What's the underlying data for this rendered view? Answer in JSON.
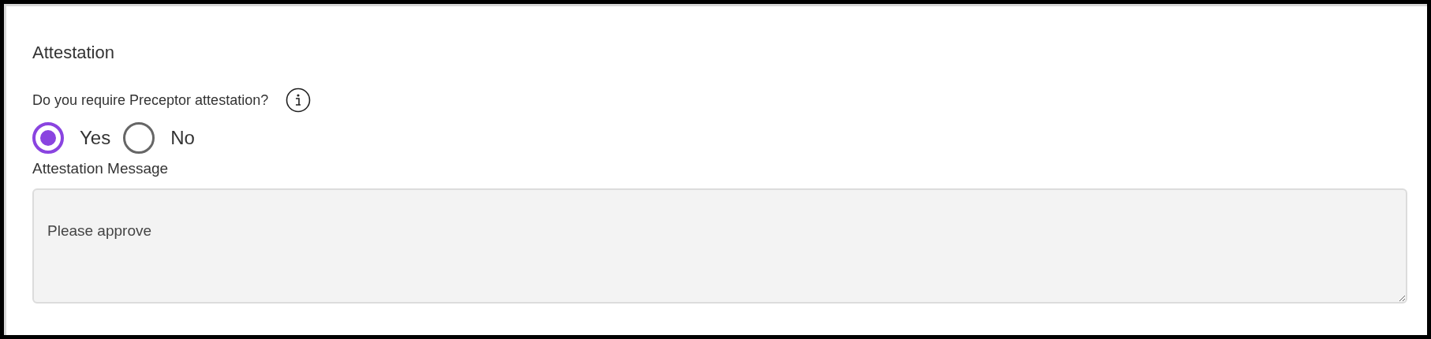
{
  "section": {
    "title": "Attestation"
  },
  "question": {
    "label": "Do you require Preceptor attestation?"
  },
  "options": [
    {
      "label": "Yes",
      "selected": true
    },
    {
      "label": "No",
      "selected": false
    }
  ],
  "message": {
    "label": "Attestation Message",
    "value": "Please approve"
  }
}
